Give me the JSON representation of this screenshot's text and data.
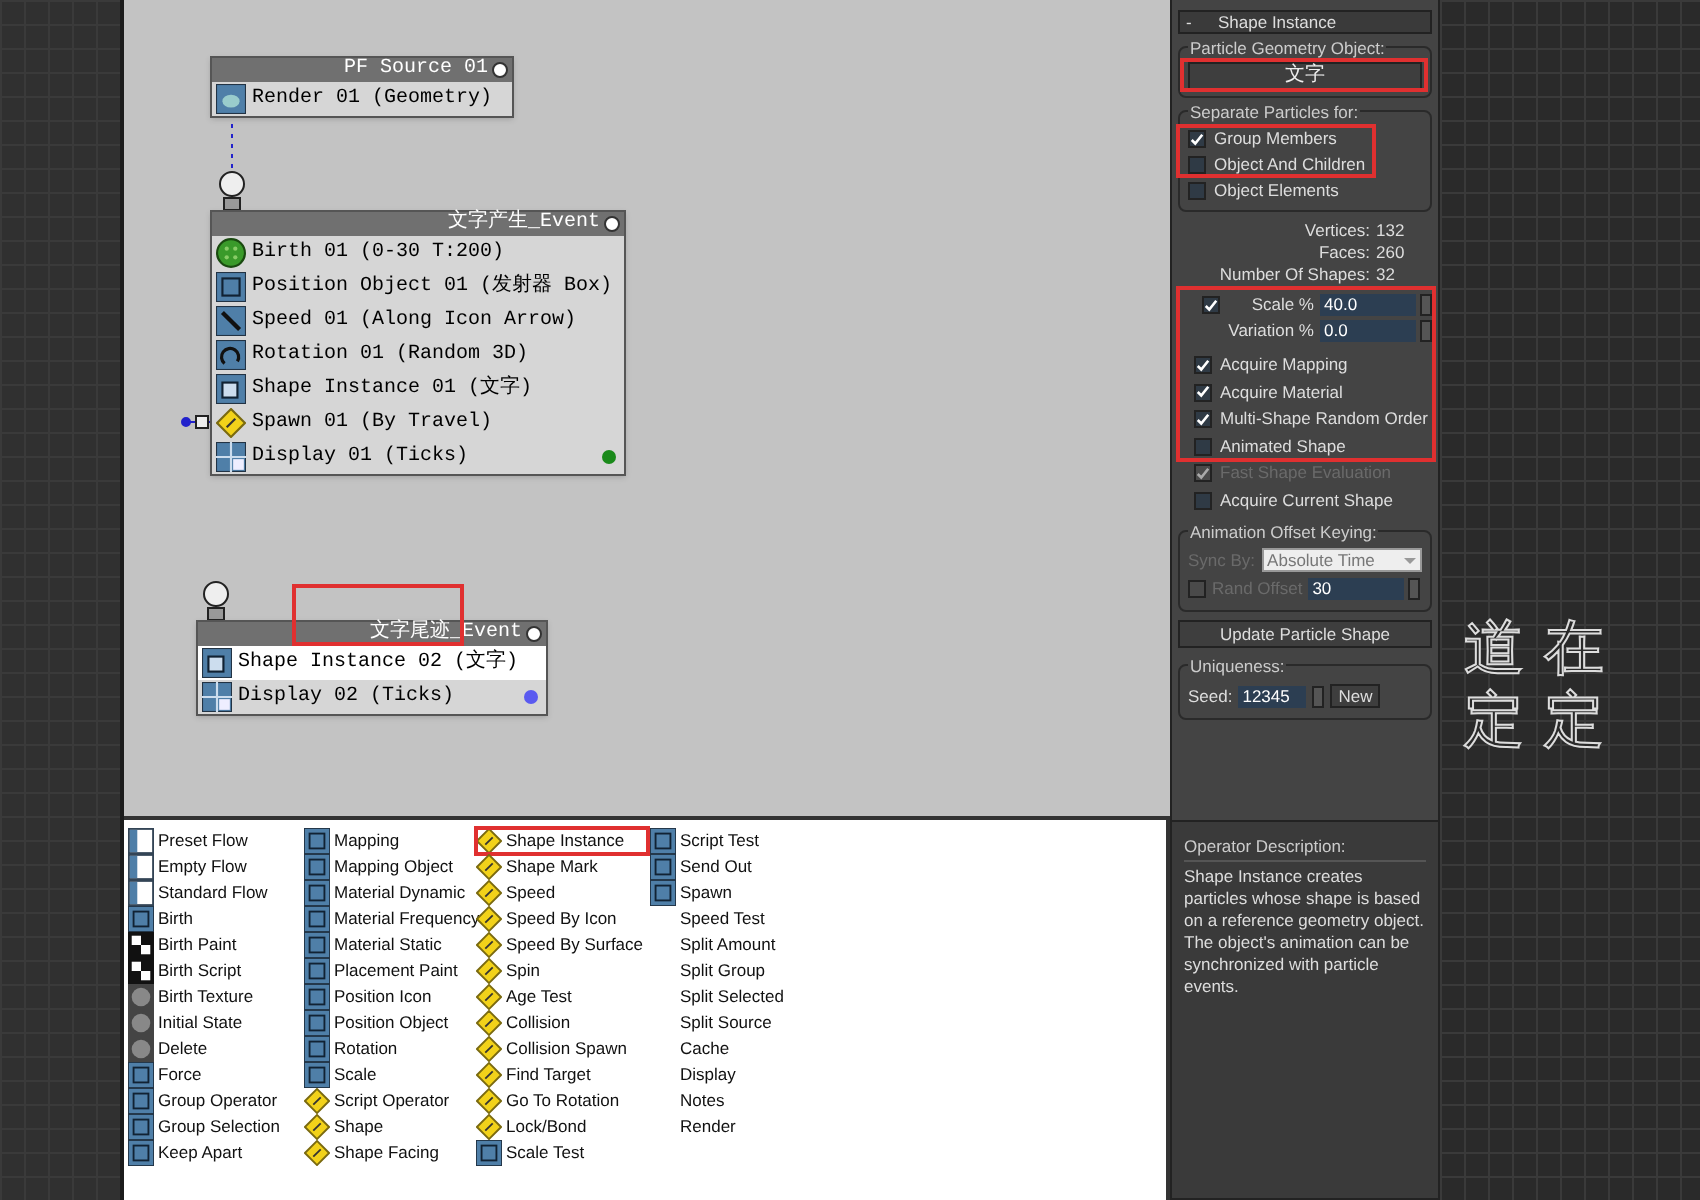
{
  "flow_nodes": [
    {
      "title": "PF Source 01",
      "items": [
        {
          "label": "Render 01 (Geometry)",
          "kind": "render",
          "selected": false
        }
      ]
    },
    {
      "title": "文字产生_Event",
      "items": [
        {
          "label": "Birth 01 (0-30 T:200)",
          "kind": "birth",
          "selected": false
        },
        {
          "label": "Position Object 01 (发射器 Box)",
          "kind": "position",
          "selected": false
        },
        {
          "label": "Speed 01 (Along Icon Arrow)",
          "kind": "speed",
          "selected": false
        },
        {
          "label": "Rotation 01 (Random 3D)",
          "kind": "rotation",
          "selected": false
        },
        {
          "label": "Shape Instance 01 (文字)",
          "kind": "shape",
          "selected": false
        },
        {
          "label": "Spawn 01 (By Travel)",
          "kind": "test",
          "selected": false
        },
        {
          "label": "Display 01 (Ticks)",
          "kind": "display",
          "selected": false,
          "color": "#1a8a1a"
        }
      ]
    },
    {
      "title": "文字尾迹_Event",
      "items": [
        {
          "label": "Shape Instance 02 (文字)",
          "kind": "shape",
          "selected": true
        },
        {
          "label": "Display 02 (Ticks)",
          "kind": "display",
          "selected": false,
          "color": "#5a5af0"
        }
      ]
    }
  ],
  "depot": [
    [
      {
        "label": "Preset Flow",
        "kind": "flow"
      },
      {
        "label": "Empty Flow",
        "kind": "flow"
      },
      {
        "label": "Standard Flow",
        "kind": "flow"
      },
      {
        "label": "Birth",
        "kind": "operator"
      },
      {
        "label": "Birth Paint",
        "kind": "checker"
      },
      {
        "label": "Birth Script",
        "kind": "checker"
      },
      {
        "label": "Birth Texture",
        "kind": "sphere"
      },
      {
        "label": "Initial State",
        "kind": "sphere"
      },
      {
        "label": "Delete",
        "kind": "sphere"
      },
      {
        "label": "Force",
        "kind": "operator"
      },
      {
        "label": "Group Operator",
        "kind": "operator"
      },
      {
        "label": "Group Selection",
        "kind": "operator"
      },
      {
        "label": "Keep Apart",
        "kind": "operator"
      }
    ],
    [
      {
        "label": "Mapping",
        "kind": "operator"
      },
      {
        "label": "Mapping Object",
        "kind": "operator"
      },
      {
        "label": "Material Dynamic",
        "kind": "operator"
      },
      {
        "label": "Material Frequency",
        "kind": "operator"
      },
      {
        "label": "Material Static",
        "kind": "operator"
      },
      {
        "label": "Placement Paint",
        "kind": "operator"
      },
      {
        "label": "Position Icon",
        "kind": "operator"
      },
      {
        "label": "Position Object",
        "kind": "operator"
      },
      {
        "label": "Rotation",
        "kind": "operator"
      },
      {
        "label": "Scale",
        "kind": "operator"
      },
      {
        "label": "Script Operator",
        "kind": "test"
      },
      {
        "label": "Shape",
        "kind": "test"
      },
      {
        "label": "Shape Facing",
        "kind": "test"
      }
    ],
    [
      {
        "label": "Shape Instance",
        "kind": "test",
        "highlighted": true
      },
      {
        "label": "Shape Mark",
        "kind": "test"
      },
      {
        "label": "Speed",
        "kind": "test"
      },
      {
        "label": "Speed By Icon",
        "kind": "test"
      },
      {
        "label": "Speed By Surface",
        "kind": "test"
      },
      {
        "label": "Spin",
        "kind": "test"
      },
      {
        "label": "Age Test",
        "kind": "test"
      },
      {
        "label": "Collision",
        "kind": "test"
      },
      {
        "label": "Collision Spawn",
        "kind": "test"
      },
      {
        "label": "Find Target",
        "kind": "test"
      },
      {
        "label": "Go To Rotation",
        "kind": "test"
      },
      {
        "label": "Lock/Bond",
        "kind": "test"
      },
      {
        "label": "Scale Test",
        "kind": "operator"
      }
    ],
    [
      {
        "label": "Script Test",
        "kind": "operator"
      },
      {
        "label": "Send Out",
        "kind": "operator"
      },
      {
        "label": "Spawn",
        "kind": "operator"
      },
      {
        "label": "Speed Test",
        "kind": "none"
      },
      {
        "label": "Split Amount",
        "kind": "none"
      },
      {
        "label": "Split Group",
        "kind": "none"
      },
      {
        "label": "Split Selected",
        "kind": "none"
      },
      {
        "label": "Split Source",
        "kind": "none"
      },
      {
        "label": "Cache",
        "kind": "none"
      },
      {
        "label": "Display",
        "kind": "none"
      },
      {
        "label": "Notes",
        "kind": "none"
      },
      {
        "label": "Render",
        "kind": "none"
      }
    ]
  ],
  "panel": {
    "rollout_toggle": "-",
    "rollout_title": "Shape Instance",
    "geometry_group": "Particle Geometry Object:",
    "geometry_button": "文字",
    "separate_group": "Separate Particles for:",
    "separate_options": [
      {
        "label": "Group Members",
        "checked": true
      },
      {
        "label": "Object And Children",
        "checked": false
      },
      {
        "label": "Object Elements",
        "checked": false
      }
    ],
    "stats": [
      {
        "label": "Vertices:",
        "value": "132"
      },
      {
        "label": "Faces:",
        "value": "260"
      },
      {
        "label": "Number Of Shapes:",
        "value": "32"
      }
    ],
    "scale": {
      "checked": true,
      "label": "Scale %",
      "value": "40.0"
    },
    "variation": {
      "label": "Variation %",
      "value": "0.0"
    },
    "options": [
      {
        "label": "Acquire Mapping",
        "checked": true,
        "disabled": false
      },
      {
        "label": "Acquire Material",
        "checked": true,
        "disabled": false
      },
      {
        "label": "Multi-Shape Random Order",
        "checked": true,
        "disabled": false
      },
      {
        "label": "Animated Shape",
        "checked": false,
        "disabled": false
      },
      {
        "label": "Fast Shape Evaluation",
        "checked": true,
        "disabled": true
      },
      {
        "label": "Acquire Current Shape",
        "checked": false,
        "disabled": false
      }
    ],
    "offset_group": "Animation Offset Keying:",
    "sync_label": "Sync By:",
    "sync_value": "Absolute Time",
    "rand_offset": {
      "label": "Rand Offset",
      "checked": false,
      "value": "30"
    },
    "update_button": "Update Particle Shape",
    "uniqueness_group": "Uniqueness:",
    "seed_label": "Seed:",
    "seed_value": "12345",
    "new_button": "New",
    "description_group": "Operator Description:",
    "description": "Shape Instance creates particles whose shape is based on a reference geometry object. The object's animation can be synchronized with particle events."
  },
  "viewport_text": [
    "道在",
    "定定"
  ]
}
